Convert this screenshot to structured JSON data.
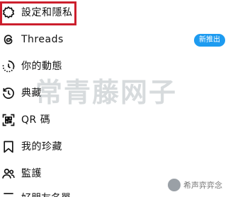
{
  "menu": {
    "items": [
      {
        "label": "設定和隱私",
        "icon": "settings-gear-icon"
      },
      {
        "label": "Threads",
        "icon": "threads-icon",
        "badge": "新推出"
      },
      {
        "label": "你的動態",
        "icon": "activity-clock-icon"
      },
      {
        "label": "典藏",
        "icon": "archive-history-icon"
      },
      {
        "label": "QR 碼",
        "icon": "qr-code-scan-icon"
      },
      {
        "label": "我的珍藏",
        "icon": "bookmark-icon"
      },
      {
        "label": "監護",
        "icon": "supervision-people-icon"
      }
    ],
    "partial_item_label": "好朋友名單"
  },
  "watermark": {
    "text": "常青藤网子"
  },
  "corner_logo": {
    "text": "希声弈弈念"
  },
  "colors": {
    "highlight_border": "#cc1f2d",
    "badge_background": "#1d9bf0",
    "text": "#111111"
  }
}
